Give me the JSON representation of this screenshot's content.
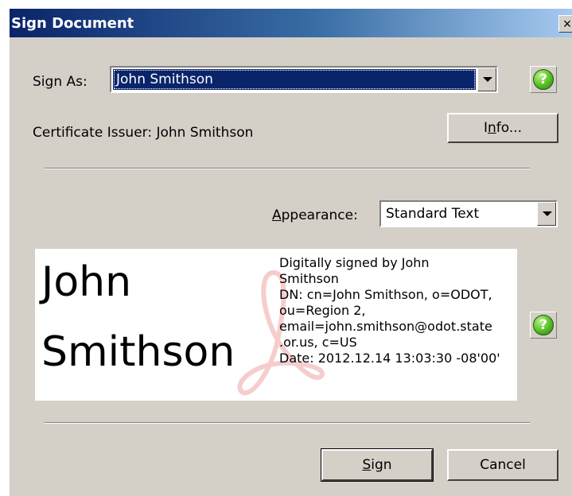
{
  "dialog": {
    "title": "Sign Document",
    "close_glyph": "×"
  },
  "sign_as": {
    "label_pre": "Si",
    "label_accel": "g",
    "label_post": "n As:",
    "value": "John Smithson"
  },
  "certificate": {
    "issuer_text": "Certificate Issuer: John Smithson",
    "info_pre": "I",
    "info_accel": "n",
    "info_post": "fo..."
  },
  "appearance": {
    "label_accel": "A",
    "label_post": "ppearance:",
    "value": "Standard Text"
  },
  "signature_preview": {
    "first_name": "John",
    "last_name": "Smithson",
    "lines": [
      "Digitally signed by John",
      "Smithson",
      "DN: cn=John Smithson, o=ODOT,",
      "ou=Region 2,",
      "email=john.smithson@odot.state",
      ".or.us, c=US",
      "Date: 2012.12.14 13:03:30 -08'00'"
    ]
  },
  "buttons": {
    "sign_accel": "S",
    "sign_post": "ign",
    "cancel": "Cancel"
  },
  "icons": {
    "help_glyph": "?",
    "accent": "#0a246a"
  }
}
